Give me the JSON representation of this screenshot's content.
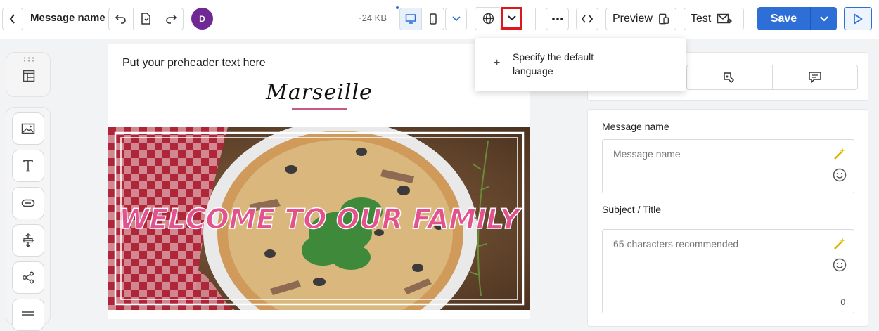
{
  "header": {
    "message_name": "Message name",
    "avatar_initial": "D",
    "size": "~24 KB",
    "preview_label": "Preview",
    "test_label": "Test",
    "save_label": "Save"
  },
  "language_menu": {
    "item_label": "Specify the default language"
  },
  "canvas": {
    "preheader": "Put your preheader text here",
    "logo_text": "Marseille",
    "hero_headline": "WELCOME TO OUR FAMILY"
  },
  "form": {
    "message_name_label": "Message name",
    "message_name_placeholder": "Message name",
    "subject_label": "Subject / Title",
    "subject_placeholder": "65 characters recommended",
    "subject_count": "0"
  },
  "colors": {
    "accent": "#2d6fd6",
    "avatar": "#6e2a92",
    "highlight": "#e0161b",
    "headline": "#e2528f"
  },
  "icons": [
    "back-icon",
    "undo-icon",
    "save-copy-icon",
    "redo-icon",
    "desktop-icon",
    "mobile-icon",
    "chevron-down-icon",
    "globe-icon",
    "more-icon",
    "code-icon",
    "preview-device-icon",
    "send-test-icon",
    "play-icon",
    "grid-handle-icon",
    "template-icon",
    "image-icon",
    "text-icon",
    "button-icon",
    "spacer-icon",
    "share-icon",
    "divider-icon",
    "magic-wand-icon",
    "emoji-icon",
    "palette-icon",
    "comment-icon"
  ]
}
